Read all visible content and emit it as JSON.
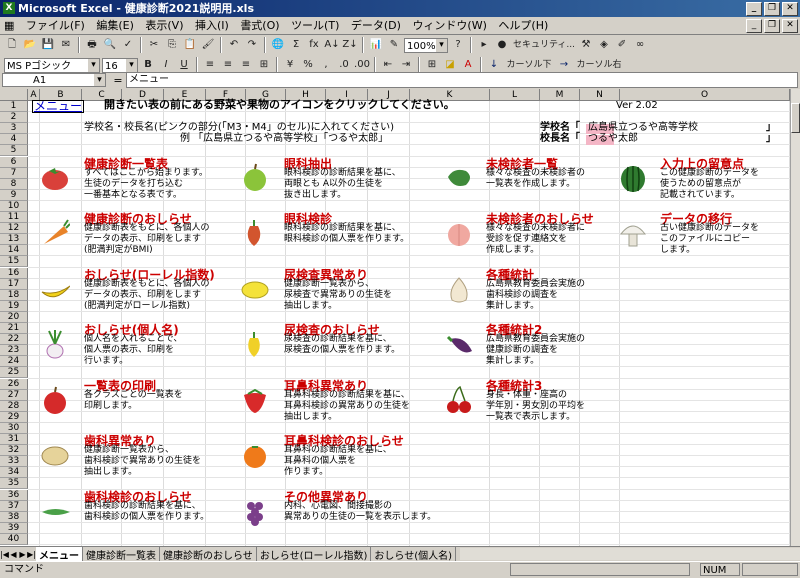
{
  "window": {
    "app_icon": "X",
    "title": "Microsoft Excel - 健康診断2021説明用.xls"
  },
  "menu": [
    "ファイル(F)",
    "編集(E)",
    "表示(V)",
    "挿入(I)",
    "書式(O)",
    "ツール(T)",
    "データ(D)",
    "ウィンドウ(W)",
    "ヘルプ(H)"
  ],
  "toolbar": {
    "zoom": "100%",
    "security_label": "セキュリティ...",
    "font_name": "MS Pゴシック",
    "font_size": "16",
    "bold": "B",
    "italic": "I",
    "underline": "U",
    "cursor_down": "カーソル下",
    "cursor_right": "カーソル右"
  },
  "formula": {
    "cell_ref": "A1",
    "fx": "=",
    "content": "メニュー"
  },
  "columns": [
    "A",
    "B",
    "C",
    "D",
    "E",
    "F",
    "G",
    "H",
    "I",
    "J",
    "K",
    "L",
    "M",
    "N",
    "O"
  ],
  "rows": [
    "1",
    "2",
    "3",
    "4",
    "5",
    "6",
    "7",
    "8",
    "9",
    "10",
    "11",
    "12",
    "13",
    "14",
    "15",
    "16",
    "17",
    "18",
    "19",
    "20",
    "21",
    "22",
    "23",
    "24",
    "25",
    "26",
    "27",
    "28",
    "29",
    "30",
    "31",
    "32",
    "33",
    "34",
    "35",
    "36",
    "37",
    "38",
    "39",
    "40"
  ],
  "sheet": {
    "menu_link": "メニュー",
    "instruction": "開きたい表の前にある野菜や果物のアイコンをクリックしてください。",
    "version": "Ver 2.02",
    "school_note": "学校名・校長名(ピンクの部分(「M3・M4」のセル)に入れてください)",
    "example": "例 「広島県立つるや高等学校」「つるや太郎」",
    "school_label": "学校名「",
    "school_value": "広島県立つるや高等学校",
    "principal_label": "校長名「",
    "principal_value": "つるや太郎",
    "close_bracket": "」"
  },
  "items": [
    {
      "title": "健康診断一覧表",
      "desc": [
        "すべてはここから始まります。",
        "生徒のデータを打ち込む",
        "一番基本となる表です。"
      ],
      "icon": "tomato-icon"
    },
    {
      "title": "健康診断のおしらせ",
      "desc": [
        "健康診断表をもとに、各個人の",
        "データの表示、印刷をします",
        "(肥満判定がBMI)"
      ],
      "icon": "carrot-icon"
    },
    {
      "title": "おしらせ(ローレル指数)",
      "desc": [
        "健康診断表をもとに、各個人の",
        "データの表示、印刷をします",
        "(肥満判定がローレル指数)"
      ],
      "icon": "banana-icon"
    },
    {
      "title": "おしらせ(個人名)",
      "desc": [
        "個人名を入れることで、",
        "個人票の表示、印刷を",
        "行います。"
      ],
      "icon": "turnip-icon"
    },
    {
      "title": "一覧表の印刷",
      "desc": [
        "各クラスごとの一覧表を",
        "印刷します。"
      ],
      "icon": "apple-icon"
    },
    {
      "title": "歯科異常あり",
      "desc": [
        "健康診断一覧表から、",
        "歯科検診で異常ありの生徒を",
        "抽出します。"
      ],
      "icon": "potato-icon"
    },
    {
      "title": "歯科検診のおしらせ",
      "desc": [
        "歯科検診の診断結果を基に、",
        "歯科検診の個人票を作ります。"
      ],
      "icon": "cucumber-icon"
    },
    {
      "title": "眼科抽出",
      "desc": [
        "眼科検診の診断結果を基に、",
        "両眼とも A以外の生徒を",
        "抜き出します。"
      ],
      "icon": "green-apple-icon"
    },
    {
      "title": "眼科検診",
      "desc": [
        "眼科検診の診断結果を基に、",
        "眼科検診の個人票を作ります。"
      ],
      "icon": "pepper-icon"
    },
    {
      "title": "尿検査異常あり",
      "desc": [
        "健康診断一覧表から、",
        "尿検査で異常ありの生徒を",
        "抽出します。"
      ],
      "icon": "lemon-icon"
    },
    {
      "title": "尿検査のおしらせ",
      "desc": [
        "尿検査の診断結果を基に、",
        "尿検査の個人票を作ります。"
      ],
      "icon": "yellow-pepper-icon"
    },
    {
      "title": "耳鼻科異常あり",
      "desc": [
        "耳鼻科検診の診断結果を基に、",
        "耳鼻科検診の異常ありの生徒を",
        "抽出します。"
      ],
      "icon": "strawberry-icon"
    },
    {
      "title": "耳鼻科検診のおしらせ",
      "desc": [
        "耳鼻科の診断結果を基に、",
        "耳鼻科の個人票を",
        "作ります。"
      ],
      "icon": "orange-icon"
    },
    {
      "title": "その他異常あり",
      "desc": [
        "内科、心電図、間接撮影の",
        "異常ありの生徒の一覧を表示します。"
      ],
      "icon": "grape-icon"
    },
    {
      "title": "未検診者一覧",
      "desc": [
        "様々な検査の未検診者の",
        "一覧表を作成します。"
      ],
      "icon": "green-pepper-icon"
    },
    {
      "title": "未検診者のおしらせ",
      "desc": [
        "様々な検査の未検診者に",
        "受診を促す連絡文を",
        "作成します。"
      ],
      "icon": "peach-icon"
    },
    {
      "title": "各種統計",
      "desc": [
        "広島県教育委員会実施の",
        "歯科検診の調査を",
        "集計します。"
      ],
      "icon": "garlic-icon"
    },
    {
      "title": "各種統計2",
      "desc": [
        "広島県教育委員会実施の",
        "健康診断の調査を",
        "集計します。"
      ],
      "icon": "eggplant-icon"
    },
    {
      "title": "各種統計3",
      "desc": [
        "身長・体重・座高の",
        "学年別・男女別の平均を",
        "一覧表で表示します。"
      ],
      "icon": "cherry-icon"
    },
    {
      "title": "入力上の留意点",
      "desc": [
        "この健康診断のデータを",
        "使うための留意点が",
        "記載されています。"
      ],
      "icon": "watermelon-icon"
    },
    {
      "title": "データの移行",
      "desc": [
        "古い健康診断のデータを",
        "このファイルにコピー",
        "します。"
      ],
      "icon": "mushroom-icon"
    }
  ],
  "tabs": [
    "メニュー",
    "健康診断一覧表",
    "健康診断のおしらせ",
    "おしらせ(ローレル指数)",
    "おしらせ(個人名)"
  ],
  "status": {
    "mode": "コマンド",
    "num": "NUM"
  }
}
